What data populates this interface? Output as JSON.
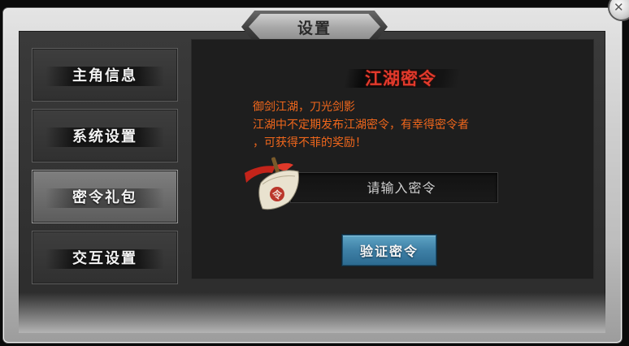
{
  "window": {
    "title": "设置"
  },
  "sidebar": {
    "items": [
      {
        "label": "主角信息",
        "active": false
      },
      {
        "label": "系统设置",
        "active": false
      },
      {
        "label": "密令礼包",
        "active": true
      },
      {
        "label": "交互设置",
        "active": false
      }
    ]
  },
  "panel": {
    "heading": "江湖密令",
    "description": [
      "御剑江湖，刀光剑影",
      "江湖中不定期发布江湖密令，有幸得密令者",
      "，可获得不菲的奖励！"
    ],
    "code_input": {
      "value": "",
      "placeholder": "请输入密令"
    },
    "scroll_icon": {
      "icon": "scroll-icon",
      "seal_text": "令"
    },
    "verify_button": {
      "label": "验证密令"
    }
  },
  "colors": {
    "heading_red": "#e23a2c",
    "description_orange": "#f0671c",
    "button_blue": "#3e80a6"
  }
}
